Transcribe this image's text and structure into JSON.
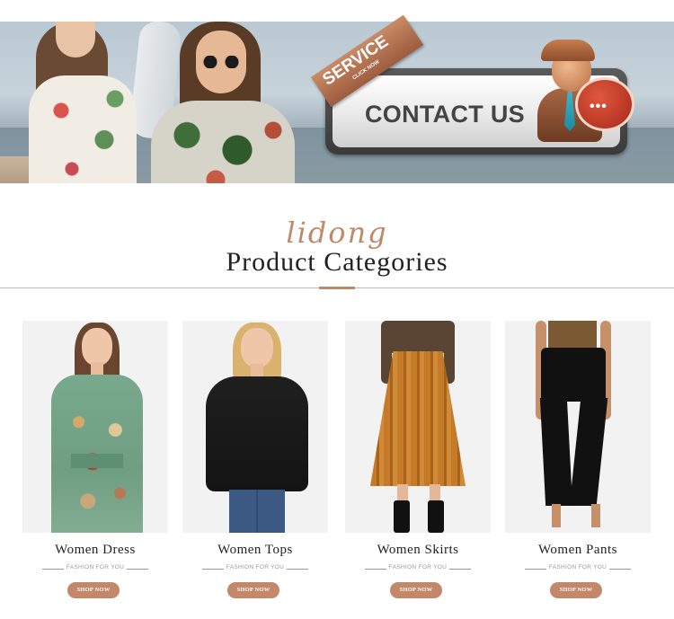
{
  "banner": {
    "service_label": "SERVICE",
    "service_sub": "CLICK NOW",
    "contact_label": "CONTACT US",
    "agent_dots": "•••"
  },
  "heading": {
    "script": "lidong",
    "title": "Product Categories"
  },
  "accent_color": "#c3876a",
  "categories": [
    {
      "name": "Women Dress",
      "tagline": "FASHION FOR YOU",
      "button": "SHOP NOW"
    },
    {
      "name": "Women Tops",
      "tagline": "FASHION FOR YOU",
      "button": "SHOP NOW"
    },
    {
      "name": "Women Skirts",
      "tagline": "FASHION FOR YOU",
      "button": "SHOP NOW"
    },
    {
      "name": "Women Pants",
      "tagline": "FASHION FOR YOU",
      "button": "SHOP NOW"
    }
  ]
}
